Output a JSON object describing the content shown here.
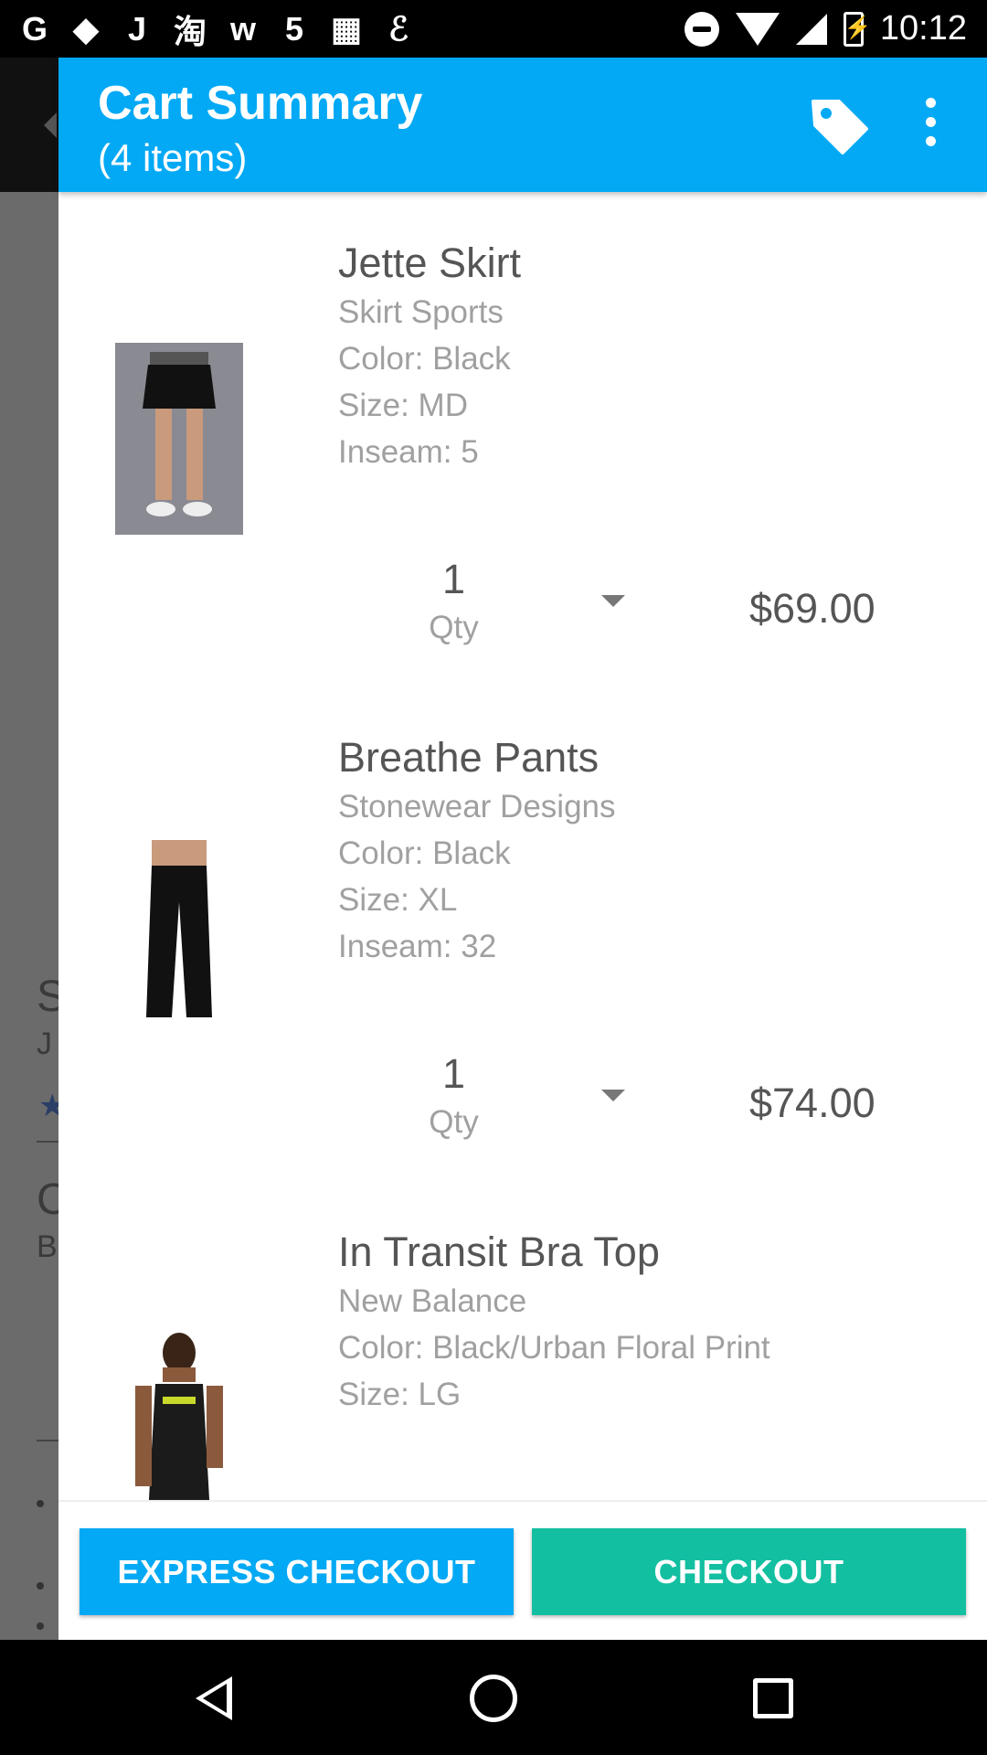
{
  "status_bar": {
    "left_icons": [
      "G",
      "◆",
      "J",
      "淘",
      "w",
      "5",
      "▦",
      "ℰ"
    ],
    "time": "10:12"
  },
  "underlay": {
    "letters": [
      "S",
      "J",
      "C",
      "B"
    ]
  },
  "header": {
    "title": "Cart Summary",
    "subtitle": "(4 items)"
  },
  "items": [
    {
      "name": "Jette Skirt",
      "brand": "Skirt Sports",
      "details": [
        "Color: Black",
        "Size: MD",
        "Inseam: 5"
      ],
      "qty": "1",
      "qty_label": "Qty",
      "price": "$69.00"
    },
    {
      "name": "Breathe Pants",
      "brand": "Stonewear Designs",
      "details": [
        "Color: Black",
        "Size: XL",
        "Inseam: 32"
      ],
      "qty": "1",
      "qty_label": "Qty",
      "price": "$74.00"
    },
    {
      "name": "In Transit Bra Top",
      "brand": "New Balance",
      "details": [
        "Color: Black/Urban Floral Print",
        "Size: LG"
      ]
    }
  ],
  "buttons": {
    "express_checkout": "EXPRESS CHECKOUT",
    "checkout": "CHECKOUT"
  },
  "colors": {
    "primary": "#03a9f4",
    "accent": "#12bfa0"
  }
}
